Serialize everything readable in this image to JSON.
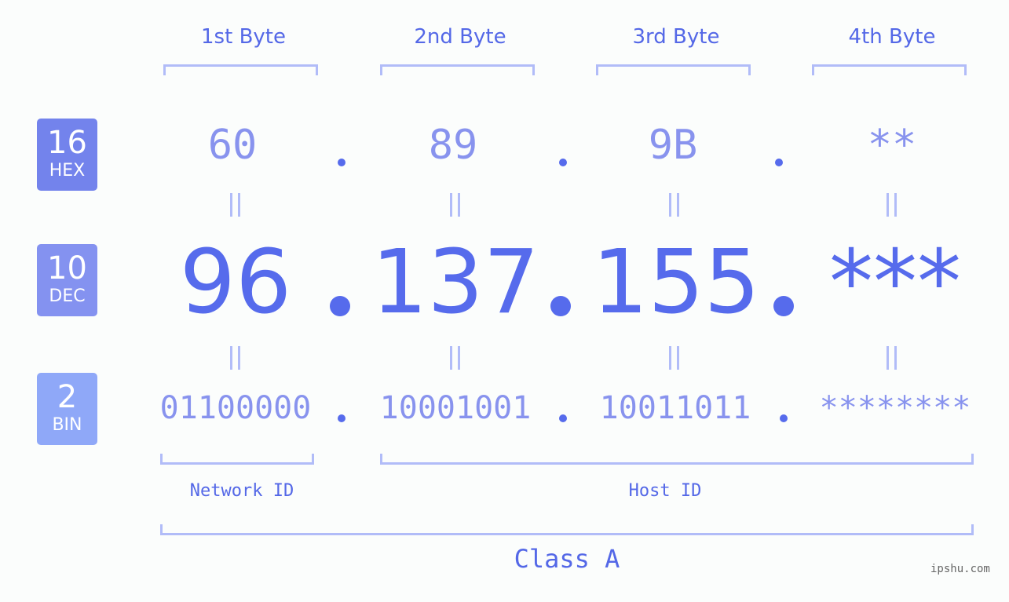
{
  "badges": [
    {
      "num": "16",
      "label": "HEX",
      "color": "#7383ec"
    },
    {
      "num": "10",
      "label": "DEC",
      "color": "#8492f0"
    },
    {
      "num": "2",
      "label": "BIN",
      "color": "#8fa8f8"
    }
  ],
  "byte_headers": [
    "1st Byte",
    "2nd Byte",
    "3rd Byte",
    "4th Byte"
  ],
  "hex": [
    "60",
    "89",
    "9B",
    "**"
  ],
  "dec": [
    "96",
    "137",
    "155",
    "***"
  ],
  "bin": [
    "01100000",
    "10001001",
    "10011011",
    "********"
  ],
  "network_label": "Network ID",
  "host_label": "Host ID",
  "class_label": "Class A",
  "watermark": "ipshu.com",
  "colors": {
    "accent": "#566bec",
    "light": "#8893ee",
    "bracket": "#b1bcf8"
  }
}
